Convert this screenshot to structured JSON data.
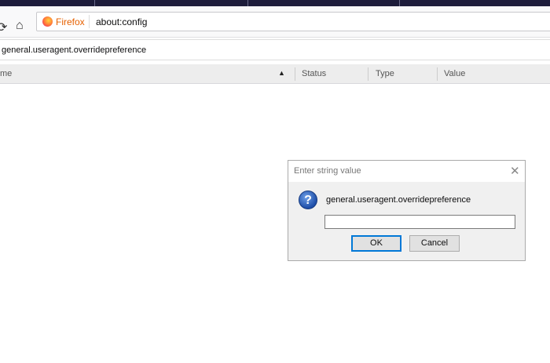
{
  "browser": {
    "brand": "Firefox",
    "url": "about:config"
  },
  "search": {
    "value": "general.useragent.overridepreference"
  },
  "columns": [
    "me",
    "Status",
    "Type",
    "Value"
  ],
  "dialog": {
    "title": "Enter string value",
    "message": "general.useragent.overridepreference",
    "input_value": "",
    "ok_label": "OK",
    "cancel_label": "Cancel",
    "close_glyph": "✕",
    "icon_glyph": "?"
  },
  "icons": {
    "reload": "⟳",
    "home": "⌂",
    "sort": "▲"
  }
}
